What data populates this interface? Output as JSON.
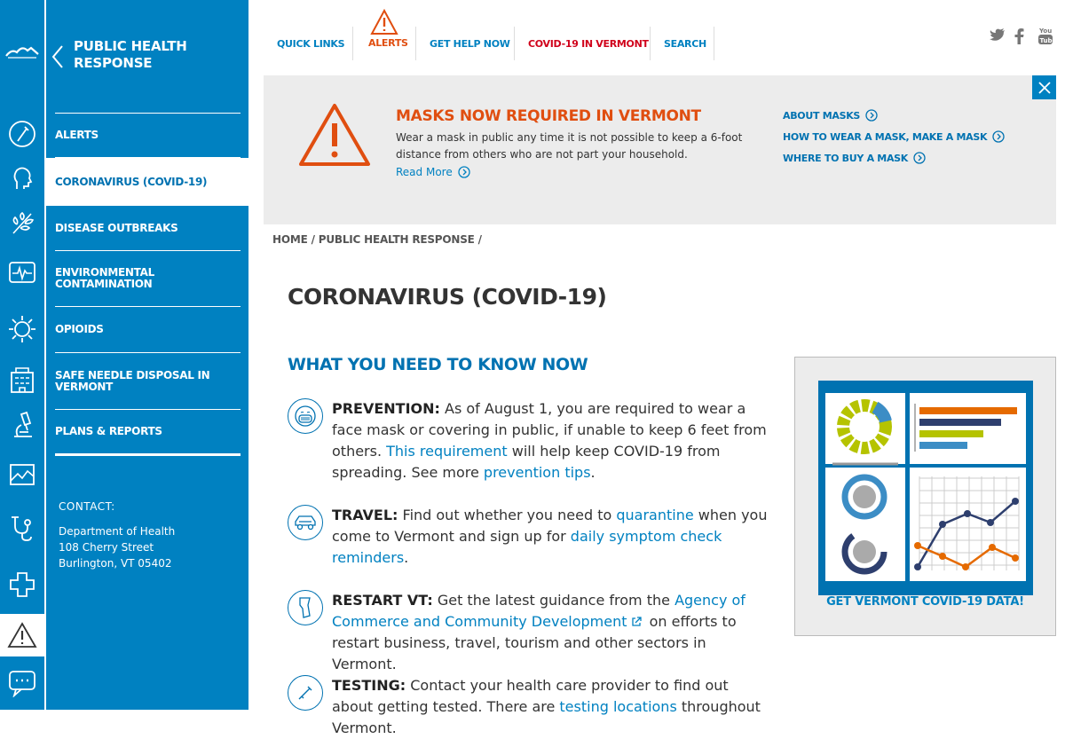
{
  "section": {
    "title": "PUBLIC HEALTH RESPONSE",
    "items": [
      {
        "label": "ALERTS"
      },
      {
        "label": "CORONAVIRUS (COVID-19)",
        "active": true
      },
      {
        "label": "DISEASE OUTBREAKS"
      },
      {
        "label": "ENVIRONMENTAL CONTAMINATION"
      },
      {
        "label": "OPIOIDS"
      },
      {
        "label": "SAFE NEEDLE DISPOSAL IN VERMONT"
      },
      {
        "label": "PLANS & REPORTS"
      }
    ],
    "contact": {
      "label": "CONTACT:",
      "org": "Department of Health",
      "street": "108 Cherry Street",
      "city": "Burlington, VT 05402"
    }
  },
  "rail": {
    "icons": [
      "logo-icon",
      "lab-flask-icon",
      "head-profile-icon",
      "plant-icon",
      "heart-monitor-icon",
      "virus-icon",
      "building-icon",
      "microscope-icon",
      "chart-image-icon",
      "stethoscope-icon",
      "medical-cross-icon",
      "alert-triangle-icon",
      "chat-bubble-icon"
    ]
  },
  "topnav": {
    "quick_links": "QUICK LINKS",
    "alerts": "ALERTS",
    "get_help": "GET HELP NOW",
    "covid": "COVID-19 IN VERMONT",
    "search": "SEARCH"
  },
  "banner": {
    "title": "MASKS NOW REQUIRED IN VERMONT",
    "body": "Wear a mask in public any time it is not possible to keep a 6-foot distance from others who are not part your household.",
    "read_more": "Read More",
    "links": [
      "ABOUT MASKS",
      "HOW TO WEAR A MASK, MAKE A MASK",
      "WHERE TO BUY A MASK"
    ]
  },
  "breadcrumb": {
    "home": "HOME",
    "sep1": "/",
    "section": "PUBLIC HEALTH RESPONSE",
    "sep2": "/"
  },
  "main": {
    "title": "CORONAVIRUS (COVID-19)",
    "heading": "WHAT YOU NEED TO KNOW NOW",
    "prevention": {
      "label": "PREVENTION:",
      "text1": " As of August 1, you are required to wear a face mask or covering in public, if unable to keep 6 feet from others. ",
      "link1": "This requirement",
      "text2": " will help keep COVID-19 from spreading. See more ",
      "link2": "prevention tips",
      "text3": "."
    },
    "travel": {
      "label": "TRAVEL:",
      "text1": " Find out whether you need to ",
      "link1": "quarantine",
      "text2": " when you come to Vermont and sign up for ",
      "link2": "daily symptom check reminders",
      "text3": "."
    },
    "restart": {
      "label": "RESTART VT:",
      "text1": " Get the latest guidance from the ",
      "link1": "Agency of Commerce and Community Development",
      "text2": " on efforts to restart business, travel, tourism and other sectors in Vermont."
    },
    "testing": {
      "label": "TESTING:",
      "text1": " Contact your health care provider to find out about getting tested. There are ",
      "link1": "testing locations",
      "text2": " throughout Vermont."
    }
  },
  "card": {
    "label": "GET VERMONT COVID-19 DATA!"
  },
  "colors": {
    "brand_blue": "#0081c1",
    "alert_orange": "#e04e10",
    "covid_red": "#d0021b"
  }
}
